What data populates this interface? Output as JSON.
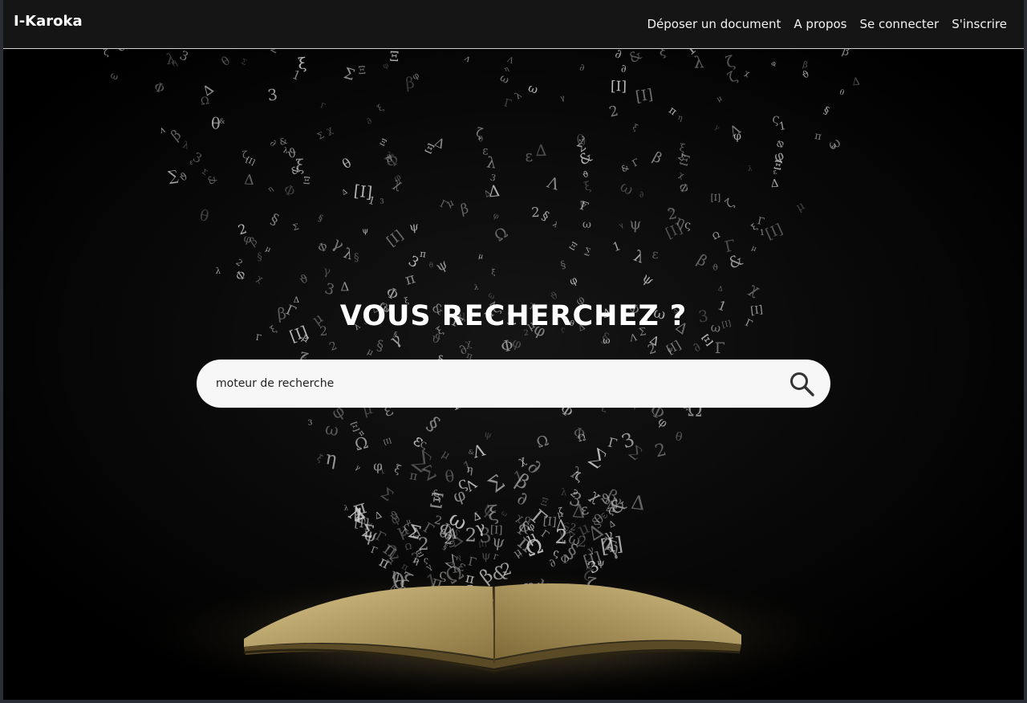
{
  "navbar": {
    "brand": "I-Karoka",
    "links": [
      {
        "label": "Déposer un document"
      },
      {
        "label": "A propos"
      },
      {
        "label": "Se connecter"
      },
      {
        "label": "S'inscrire"
      }
    ]
  },
  "hero": {
    "title": "VOUS RECHERCHEZ ?",
    "search": {
      "placeholder": "moteur de recherche",
      "button_icon": "search-icon"
    }
  }
}
